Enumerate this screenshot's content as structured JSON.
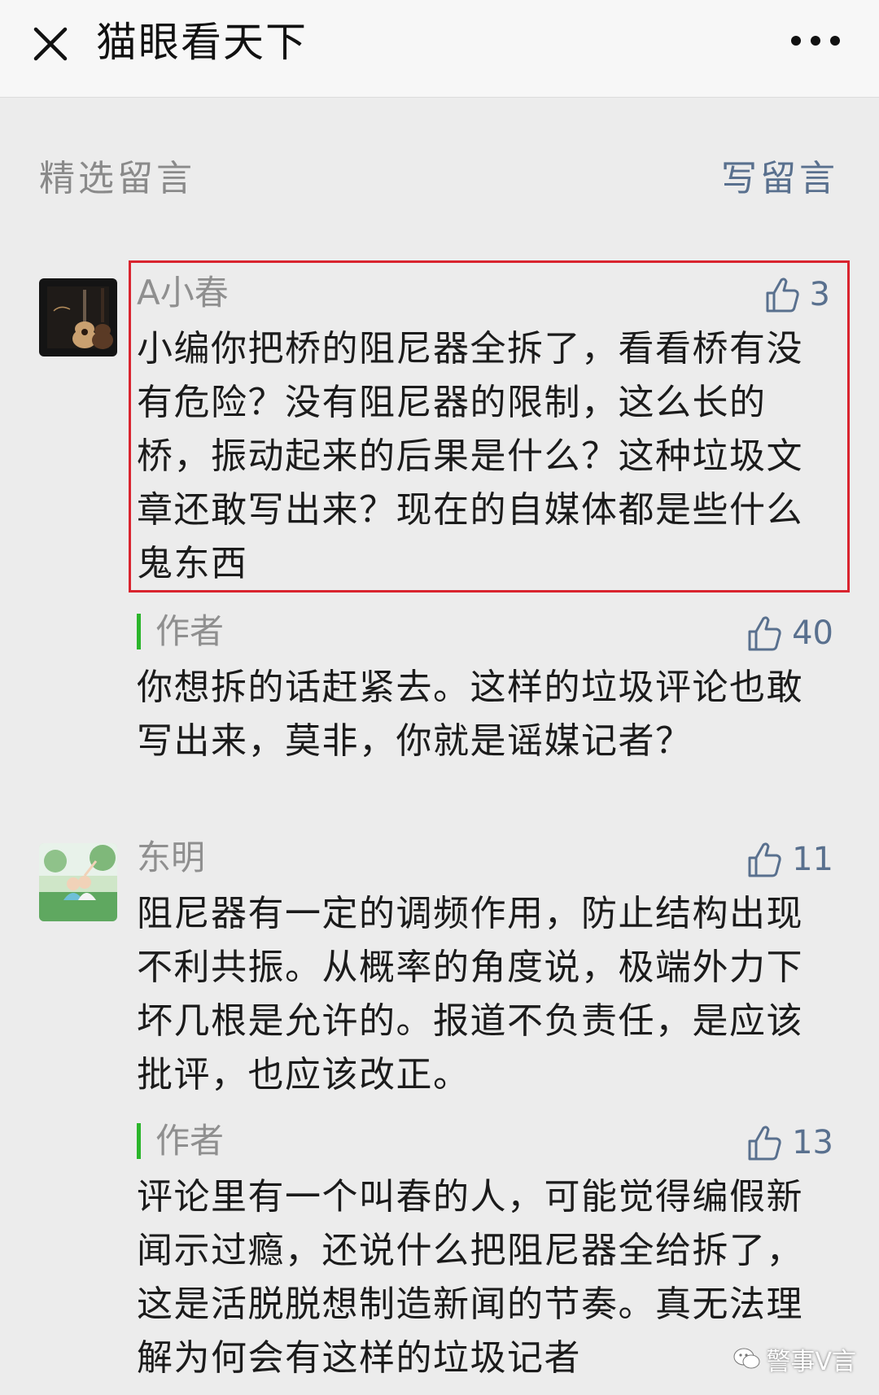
{
  "nav": {
    "close_icon": "close-icon",
    "title": "猫眼看天下",
    "more_icon": "more-icon"
  },
  "section": {
    "label": "精选留言",
    "write_label": "写留言"
  },
  "comments": [
    {
      "name": "A小春",
      "likes": "3",
      "text": "小编你把桥的阻尼器全拆了，看看桥有没有危险？没有阻尼器的限制，这么长的桥，振动起来的后果是什么？这种垃圾文章还敢写出来？现在的自媒体都是些什么鬼东西",
      "reply": {
        "label": "作者",
        "likes": "40",
        "text": "你想拆的话赶紧去。这样的垃圾评论也敢写出来，莫非，你就是谣媒记者？"
      }
    },
    {
      "name": "东明",
      "likes": "11",
      "text": "阻尼器有一定的调频作用，防止结构出现不利共振。从概率的角度说，极端外力下坏几根是允许的。报道不负责任，是应该批评，也应该改正。",
      "reply": {
        "label": "作者",
        "likes": "13",
        "text": "评论里有一个叫春的人，可能觉得编假新闻示过瘾，还说什么把阻尼器全给拆了，这是活脱脱想制造新闻的节奏。真无法理解为何会有这样的垃圾记者"
      }
    }
  ],
  "watermark": "警事V言",
  "colors": {
    "background": "#ececec",
    "link": "#59708e",
    "highlight_border": "#d9242f",
    "author_bar": "#2bb52b"
  }
}
